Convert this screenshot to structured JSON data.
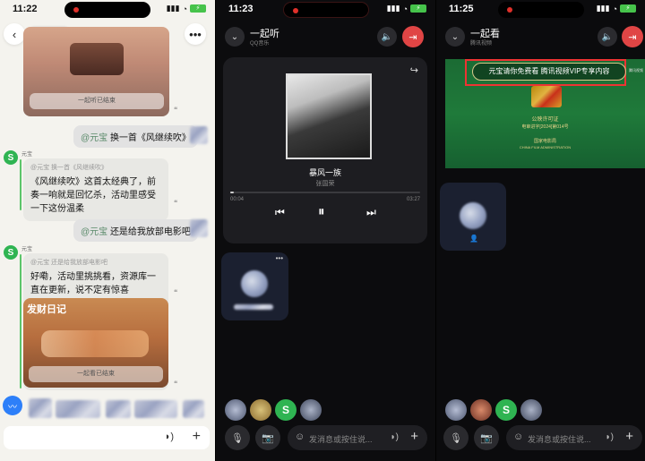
{
  "status": {
    "p1_time": "11:22",
    "p2_time": "11:23",
    "p3_time": "11:25",
    "battery_icon": "battery-charging-icon"
  },
  "p1": {
    "watched_label": "一起听已结束",
    "watched_label_2": "一起看已结束",
    "user_msg_1_mention": "@元宝",
    "user_msg_1_text": "换一首《风继续吹》",
    "bot_name": "元宝",
    "bot_quote_1": "@元宝 换一首《风继续吹》",
    "bot_msg_1": "《风继续吹》这首太经典了，前奏一响就是回忆杀，活动里感受一下这份温柔",
    "user_msg_2_mention": "@元宝",
    "user_msg_2_text": "还是给我放部电影吧",
    "bot_quote_2": "@元宝 还是给我放部电影吧",
    "bot_msg_2": "好嘞，活动里挑挑看，资源库一直在更新，说不定有惊喜",
    "movie_title": "发财日记",
    "accent": "#2fb452"
  },
  "p2": {
    "title": "一起听",
    "subtitle": "QQ音乐",
    "song": "暴风一族",
    "artist": "张国荣",
    "time_current": "00:04",
    "time_total": "03:27",
    "progress": 0.02,
    "input_placeholder": "发消息或按住说...",
    "exit_color": "#e04545"
  },
  "p3": {
    "title": "一起看",
    "subtitle": "腾讯视频",
    "vip_banner": "元宝请你免费看 腾讯视频VIP专享内容",
    "cert_title": "公映许可证",
    "cert_no": "电审进字[2024]第014号",
    "cert_org": "国家电影局",
    "cert_org_en": "CHINA FILM ADMINISTRATION",
    "input_placeholder": "发消息或按住说..."
  }
}
